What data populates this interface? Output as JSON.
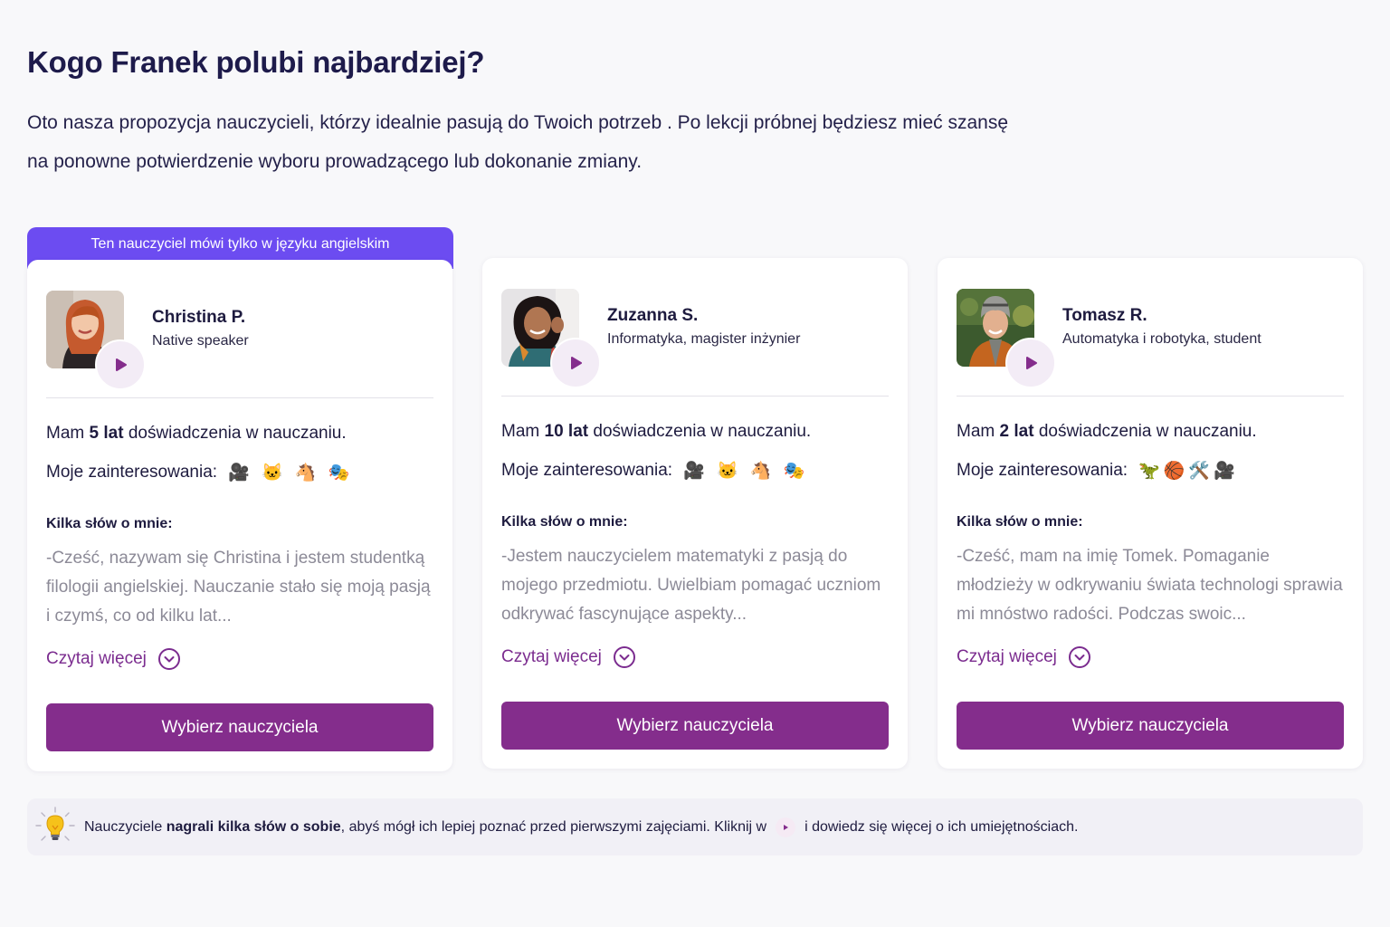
{
  "page": {
    "heading": "Kogo Franek polubi najbardziej?",
    "intro_line1": "Oto nasza propozycja nauczycieli, którzy idealnie pasują do Twoich potrzeb . Po lekcji próbnej będziesz mieć szansę",
    "intro_line2": "na ponowne potwierdzenie wyboru prowadzącego lub dokonanie zmiany."
  },
  "colors": {
    "accent_purple": "#842d8c",
    "banner_violet": "#6c4cf1",
    "heading_navy": "#1e1b4b",
    "muted_text": "#8c8a97"
  },
  "teachers": [
    {
      "banner": "Ten nauczyciel mówi tylko w języku angielskim",
      "name": "Christina P.",
      "subtitle": "Native speaker",
      "exp_prefix": "Mam",
      "exp_years": "5 lat",
      "exp_suffix": "doświadczenia w nauczaniu.",
      "interests_label": "Moje zainteresowania:",
      "interests_emojis": "🎥 🐱 🐴 🎭",
      "interest_icons": [
        "video-camera-icon",
        "cat-icon",
        "horse-icon",
        "theater-masks-icon"
      ],
      "about_label": "Kilka słów o mnie:",
      "about": "-Cześć, nazywam się Christina i jestem studentką filologii angielskiej. Nauczanie stało się moją pasją i czymś, co od kilku lat...",
      "read_more": "Czytaj więcej",
      "select": "Wybierz nauczyciela"
    },
    {
      "name": "Zuzanna S.",
      "subtitle": "Informatyka, magister inżynier",
      "exp_prefix": "Mam",
      "exp_years": "10 lat",
      "exp_suffix": "doświadczenia w nauczaniu.",
      "interests_label": "Moje zainteresowania:",
      "interests_emojis": "🎥 🐱 🐴 🎭",
      "interest_icons": [
        "video-camera-icon",
        "cat-icon",
        "horse-icon",
        "theater-masks-icon"
      ],
      "about_label": "Kilka słów o mnie:",
      "about": "-Jestem nauczycielem matematyki z pasją do mojego przedmiotu. Uwielbiam pomagać uczniom odkrywać fascynujące aspekty...",
      "read_more": "Czytaj więcej",
      "select": "Wybierz nauczyciela"
    },
    {
      "name": "Tomasz R.",
      "subtitle": "Automatyka i robotyka, student",
      "exp_prefix": "Mam",
      "exp_years": "2 lat",
      "exp_suffix": "doświadczenia w nauczaniu.",
      "interests_label": "Moje zainteresowania:",
      "interests_emojis": "🦖🏀🛠️🎥",
      "interest_icons": [
        "dinosaur-icon",
        "basketball-icon",
        "tools-icon",
        "video-camera-icon"
      ],
      "about_label": "Kilka słów o mnie:",
      "about": "-Cześć, mam na imię Tomek. Pomaganie młodzieży w odkrywaniu świata technologi sprawia mi mnóstwo radości. Podczas swoic...",
      "read_more": "Czytaj więcej",
      "select": "Wybierz nauczyciela"
    }
  ],
  "tip": {
    "icon": "lightbulb-icon",
    "before": "Nauczyciele",
    "bold": "nagrali kilka słów o sobie",
    "middle": ", abyś mógł ich lepiej poznać przed pierwszymi zajęciami. Kliknij w",
    "after": "i dowiedz się więcej o ich umiejętnościach."
  }
}
